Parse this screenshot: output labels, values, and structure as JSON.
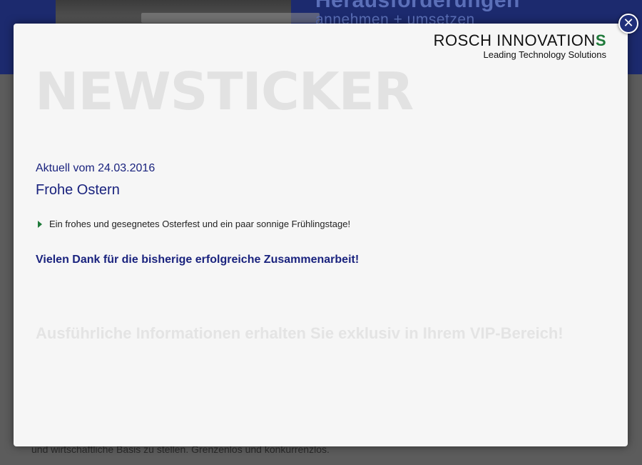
{
  "background": {
    "heading": "Herausforderungen",
    "subheading": "annehmen + umsetzen",
    "bottom_text": "und wirtschaftliche Basis zu stellen. Grenzenlos und konkurrenzlos."
  },
  "modal": {
    "logo_name": "ROSCH INNOVATION",
    "logo_s": "S",
    "logo_tagline": "Leading Technology Solutions",
    "watermark": "NEWSTICKER",
    "date_line": "Aktuell vom 24.03.2016",
    "title": "Frohe Ostern",
    "bullet": "Ein frohes und gesegnetes Osterfest und ein paar sonnige Frühlingstage!",
    "thanks": "Vielen Dank für die bisherige erfolgreiche Zusammenarbeit!",
    "vip": "Ausführliche Informationen erhalten Sie exklusiv in Ihrem VIP-Bereich!",
    "close_label": "✕"
  },
  "icons": {
    "close": "close-icon",
    "bullet": "triangle-bullet-icon"
  },
  "colors": {
    "accent": "#1a237e",
    "bullet": "#1f7a3a",
    "header_bg": "#1c2a6e"
  }
}
